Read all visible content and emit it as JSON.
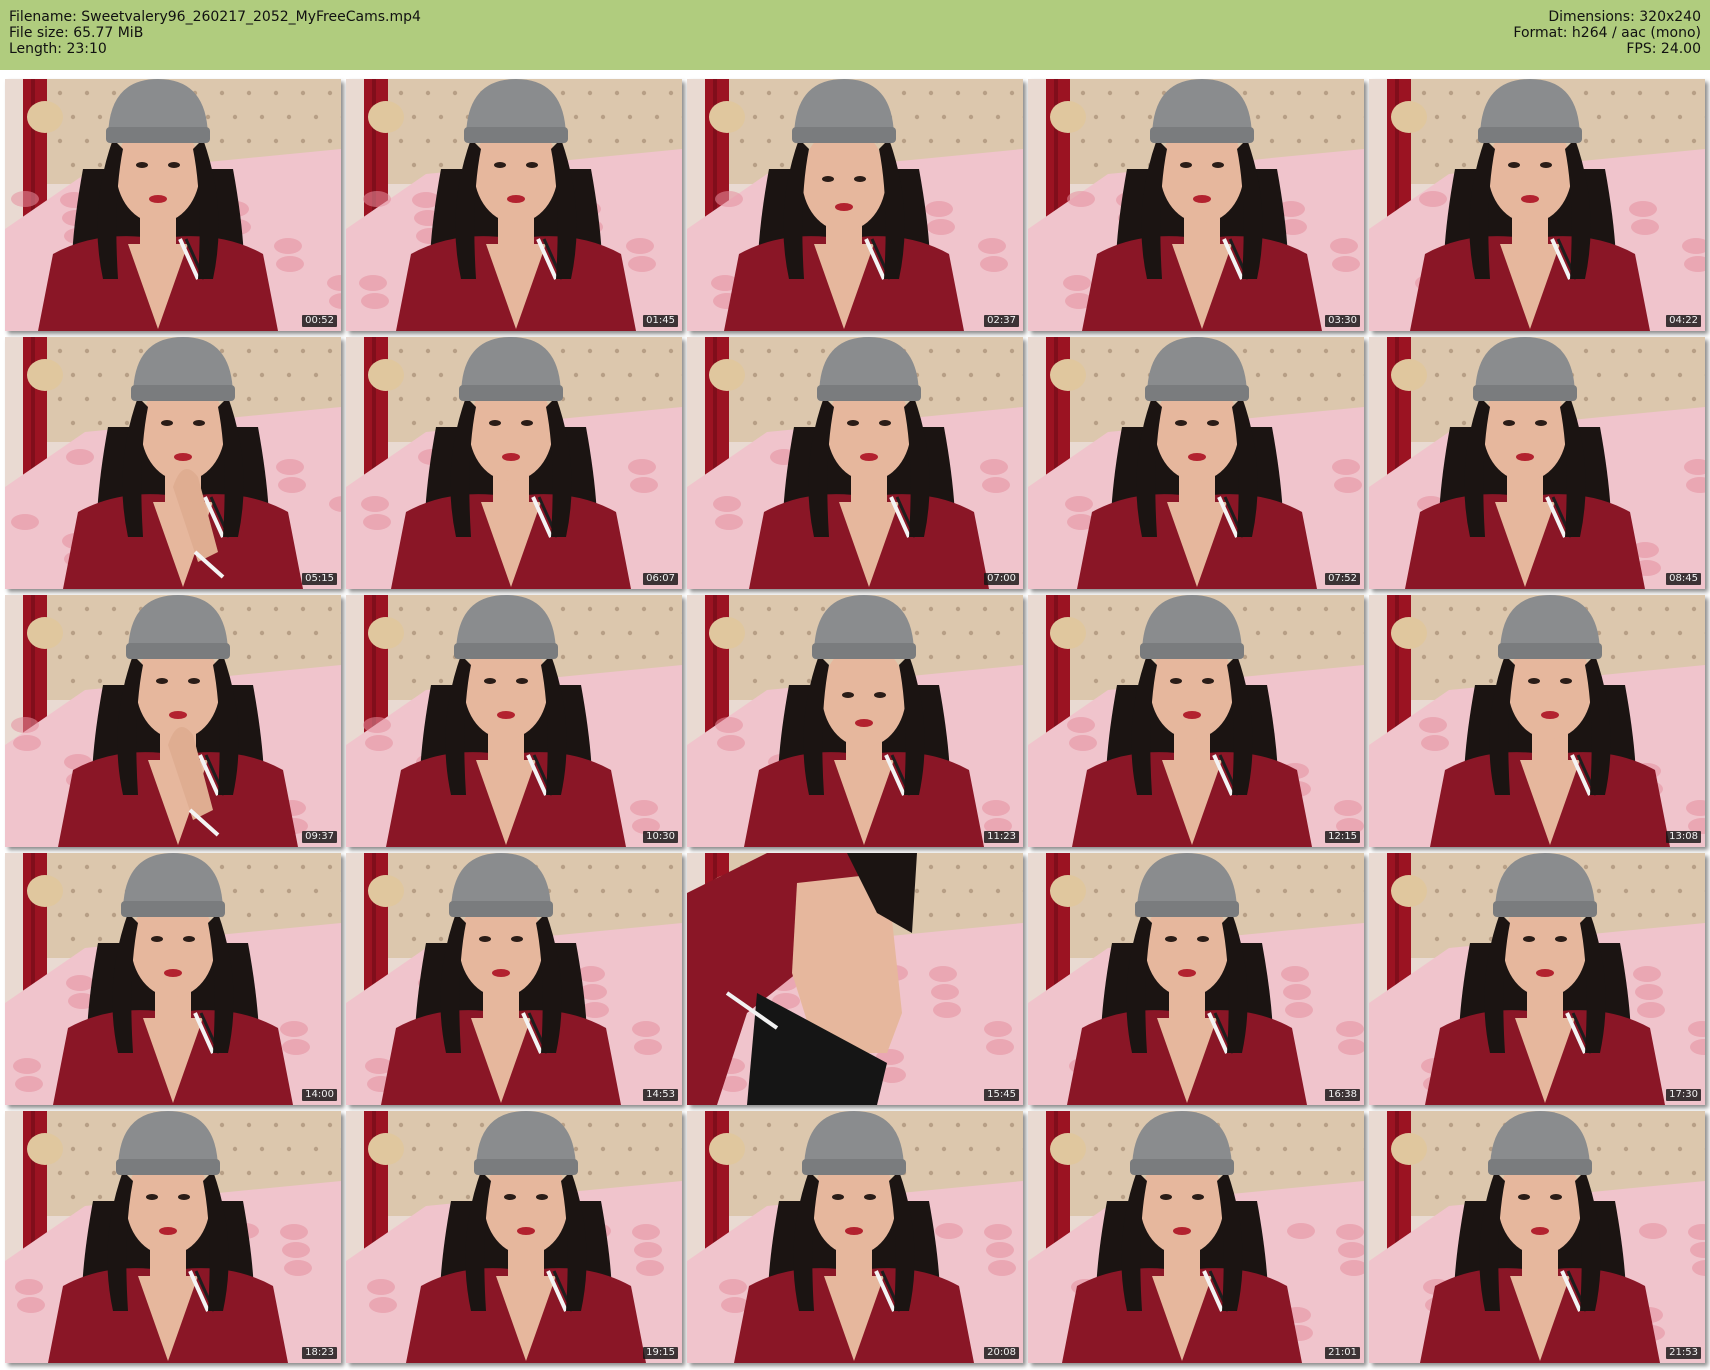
{
  "header": {
    "filename_line": "Filename: Sweetvalery96_260217_2052_MyFreeCams.mp4",
    "filesize_line": "File size: 65.77 MiB",
    "length_line": "Length: 23:10",
    "dimensions_line": "Dimensions: 320x240",
    "format_line": "Format: h264 / aac (mono)",
    "fps_line": "FPS: 24.00"
  },
  "colors": {
    "header_bg": "#b0cc7e",
    "wall": "#e9dad2",
    "headboard": "#dcc7ad",
    "curtain": "#9b1322",
    "bedding": "#f0c4cc",
    "jacket": "#8a1626",
    "beanie": "#8a8c8e",
    "hair": "#1b1412",
    "skin": "#e6b79d"
  },
  "thumbnails": [
    {
      "time": "00:52",
      "scene": "face"
    },
    {
      "time": "01:45",
      "scene": "face"
    },
    {
      "time": "02:37",
      "scene": "face-down"
    },
    {
      "time": "03:30",
      "scene": "face"
    },
    {
      "time": "04:22",
      "scene": "face"
    },
    {
      "time": "05:15",
      "scene": "face-hand"
    },
    {
      "time": "06:07",
      "scene": "face"
    },
    {
      "time": "07:00",
      "scene": "face"
    },
    {
      "time": "07:52",
      "scene": "face"
    },
    {
      "time": "08:45",
      "scene": "face"
    },
    {
      "time": "09:37",
      "scene": "face-hand"
    },
    {
      "time": "10:30",
      "scene": "face"
    },
    {
      "time": "11:23",
      "scene": "face-down"
    },
    {
      "time": "12:15",
      "scene": "face"
    },
    {
      "time": "13:08",
      "scene": "face"
    },
    {
      "time": "14:00",
      "scene": "face"
    },
    {
      "time": "14:53",
      "scene": "face"
    },
    {
      "time": "15:45",
      "scene": "torso"
    },
    {
      "time": "16:38",
      "scene": "face"
    },
    {
      "time": "17:30",
      "scene": "face"
    },
    {
      "time": "18:23",
      "scene": "face"
    },
    {
      "time": "19:15",
      "scene": "face"
    },
    {
      "time": "20:08",
      "scene": "face"
    },
    {
      "time": "21:01",
      "scene": "face"
    },
    {
      "time": "21:53",
      "scene": "face"
    }
  ]
}
